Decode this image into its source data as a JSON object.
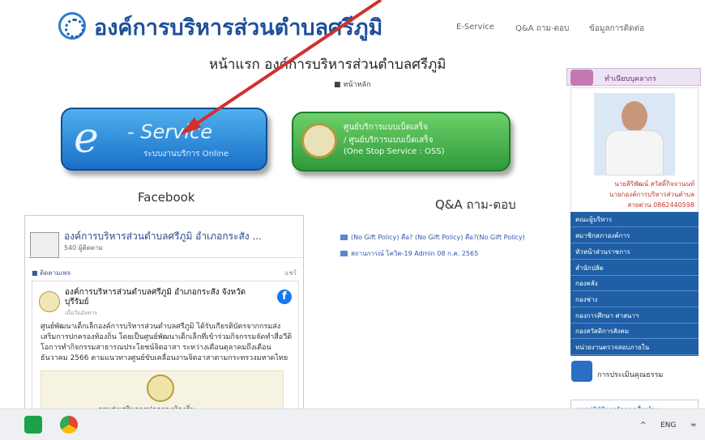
{
  "header": {
    "title": "องค์การบริหารส่วนตำบลศรีภูมิ",
    "nav": [
      "E-Service",
      "Q&A ถาม-ตอบ",
      "ข้อมูลการติดต่อ"
    ]
  },
  "page": {
    "heading": "หน้าแรก องค์การบริหารส่วนตำบลศรีภูมิ",
    "breadcrumb": "หน้าหลัก"
  },
  "eservice": {
    "letter": "e",
    "title": "- Service",
    "subtitle": "ระบบงานบริการ Online"
  },
  "oss": {
    "lines": [
      "ศูนย์บริการแบบเบ็ดเสร็จ",
      "/ ศูนย์บริการแบบเบ็ดเสร็จ",
      "(One Stop Service : OSS)"
    ]
  },
  "sections": {
    "facebook": "Facebook",
    "qa": "Q&A ถาม-ตอบ"
  },
  "facebook": {
    "page_name": "องค์การบริหารส่วนตำบลศรีภูมิ อำเภอกระสัง ...",
    "likes": "540 ผู้ติดตาม",
    "follow": "ติดตามเพจ",
    "more": "แชร์",
    "post_name": "องค์การบริหารส่วนตำบลศรีภูมิ อำเภอกระสัง จังหวัดบุรีรัมย์",
    "post_sub": "เมื่อวันอังคาร",
    "post_body": "ศูนย์พัฒนาเด็กเล็กองค์การบริหารส่วนตำบลศรีภูมิ ได้รับเกียรติบัตรจากกรมส่งเสริมการปกครองท้องถิ่น โดยเป็นศูนย์พัฒนาเด็กเล็กที่เข้าร่วมกิจกรรมจัดทำสื่อวีดิโอการทำกิจกรรมสาธารณประโยชน์จิตอาสา ระหว่างเดือนตุลาคมถึงเดือนธันวาคม 2566 ตามแนวทางศูนย์ขับเคลื่อนงานจิตอาสาตามกระทรวงมหาดไทย",
    "image_caption": "กรมส่งเสริมการปกครองท้องถิ่น"
  },
  "qa_items": [
    {
      "text": "(No Gift Policy) คือ? (No Gift Policy) คือ?(No Gift Policy)"
    },
    {
      "text": "สถานการณ์ โควิด-19   Admin   08 ก.ค. 2565"
    }
  ],
  "sidebar": {
    "header": "ทำเนียบบุคลากร",
    "person_name": "นายสิริพัฒน์ สวัสดิ์กิจจานนท์",
    "person_title": "นายกองค์การบริหารส่วนตำบล",
    "person_phone": "สายด่วน 0862440598",
    "menu": [
      "คณะผู้บริหาร",
      "สมาชิกสภาองค์การ",
      "หัวหน้าส่วนราชการ",
      "สำนักปลัด",
      "กองคลัง",
      "กองช่าง",
      "กองการศึกษา ศาสนาฯ",
      "กองสวัสดิการสังคม",
      "หน่วยงานตรวจสอบภายใน"
    ],
    "eval": "การประเมินคุณธรรม",
    "guide": "แนวปฏิบัติการจัดการเรื่องร้อง"
  },
  "taskbar": {
    "lang": "ENG"
  },
  "colors": {
    "brand": "#1d4f9a",
    "eservice": "#1a6fc8",
    "oss": "#2e9a3a",
    "sidebar_menu": "#1e5fa6",
    "arrow": "#d0312d"
  }
}
